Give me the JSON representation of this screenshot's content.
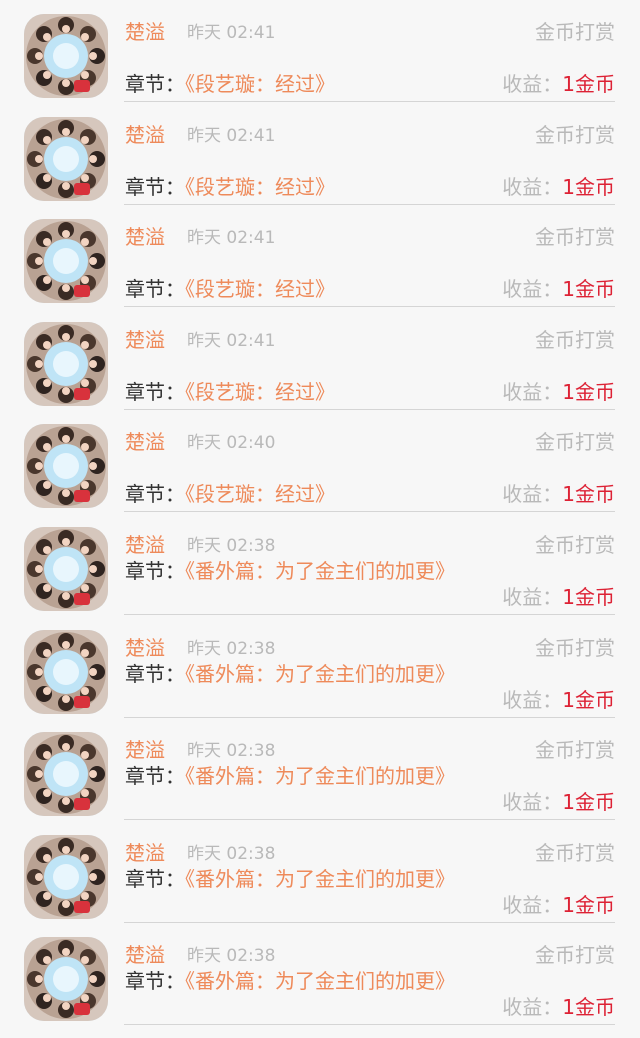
{
  "list": {
    "items": [
      {
        "name": "楚溢",
        "time": "昨天 02:41",
        "type": "金币打赏",
        "chapter_label": "章节：",
        "chapter_title": "《段艺璇：经过》",
        "income_label": "收益：",
        "income_value": "1金币",
        "wrap": false
      },
      {
        "name": "楚溢",
        "time": "昨天 02:41",
        "type": "金币打赏",
        "chapter_label": "章节：",
        "chapter_title": "《段艺璇：经过》",
        "income_label": "收益：",
        "income_value": "1金币",
        "wrap": false
      },
      {
        "name": "楚溢",
        "time": "昨天 02:41",
        "type": "金币打赏",
        "chapter_label": "章节：",
        "chapter_title": "《段艺璇：经过》",
        "income_label": "收益：",
        "income_value": "1金币",
        "wrap": false
      },
      {
        "name": "楚溢",
        "time": "昨天 02:41",
        "type": "金币打赏",
        "chapter_label": "章节：",
        "chapter_title": "《段艺璇：经过》",
        "income_label": "收益：",
        "income_value": "1金币",
        "wrap": false
      },
      {
        "name": "楚溢",
        "time": "昨天 02:40",
        "type": "金币打赏",
        "chapter_label": "章节：",
        "chapter_title": "《段艺璇：经过》",
        "income_label": "收益：",
        "income_value": "1金币",
        "wrap": false
      },
      {
        "name": "楚溢",
        "time": "昨天 02:38",
        "type": "金币打赏",
        "chapter_label": "章节：",
        "chapter_title": "《番外篇：为了金主们的加更》",
        "income_label": "收益：",
        "income_value": "1金币",
        "wrap": true
      },
      {
        "name": "楚溢",
        "time": "昨天 02:38",
        "type": "金币打赏",
        "chapter_label": "章节：",
        "chapter_title": "《番外篇：为了金主们的加更》",
        "income_label": "收益：",
        "income_value": "1金币",
        "wrap": true
      },
      {
        "name": "楚溢",
        "time": "昨天 02:38",
        "type": "金币打赏",
        "chapter_label": "章节：",
        "chapter_title": "《番外篇：为了金主们的加更》",
        "income_label": "收益：",
        "income_value": "1金币",
        "wrap": true
      },
      {
        "name": "楚溢",
        "time": "昨天 02:38",
        "type": "金币打赏",
        "chapter_label": "章节：",
        "chapter_title": "《番外篇：为了金主们的加更》",
        "income_label": "收益：",
        "income_value": "1金币",
        "wrap": true
      },
      {
        "name": "楚溢",
        "time": "昨天 02:38",
        "type": "金币打赏",
        "chapter_label": "章节：",
        "chapter_title": "《番外篇：为了金主们的加更》",
        "income_label": "收益：",
        "income_value": "1金币",
        "wrap": true
      }
    ]
  }
}
